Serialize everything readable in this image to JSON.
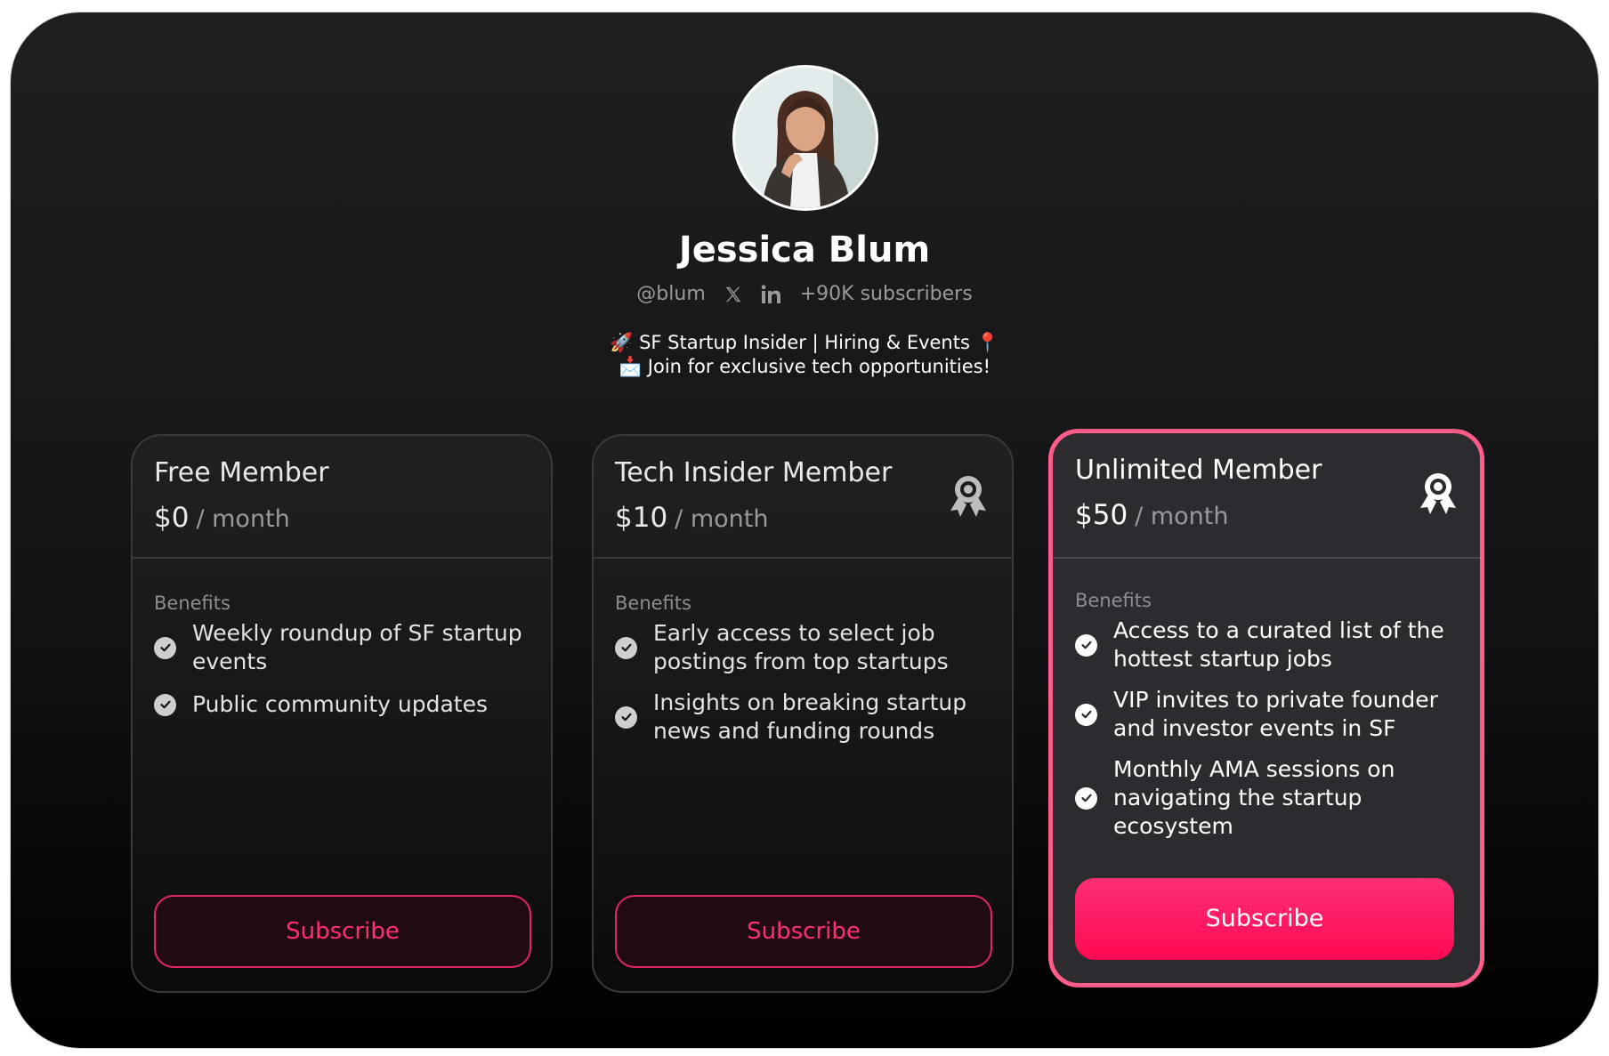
{
  "profile": {
    "name": "Jessica Blum",
    "handle": "@blum",
    "subscribers": "+90K subscribers",
    "bio_line1": "🚀 SF Startup Insider | Hiring & Events 📍",
    "bio_line2": "📩 Join for exclusive tech opportunities!",
    "social_icons": [
      "x-icon",
      "linkedin-icon"
    ]
  },
  "tiers": [
    {
      "title": "Free Member",
      "price": "$0",
      "period": "/ month",
      "benefits_label": "Benefits",
      "benefits": [
        "Weekly roundup of SF startup events",
        "Public community updates"
      ],
      "button": "Subscribe",
      "badge": false
    },
    {
      "title": "Tech Insider Member",
      "price": "$10",
      "period": "/ month",
      "benefits_label": "Benefits",
      "benefits": [
        "Early access to select job postings from top startups",
        "Insights on breaking startup news and funding rounds"
      ],
      "button": "Subscribe",
      "badge": true
    },
    {
      "title": "Unlimited Member",
      "price": "$50",
      "period": "/ month",
      "benefits_label": "Benefits",
      "benefits": [
        "Access to a curated list of the hottest startup jobs",
        "VIP invites to private founder and investor events in SF",
        "Monthly AMA sessions on navigating the startup ecosystem"
      ],
      "button": "Subscribe",
      "badge": true,
      "highlighted": true
    }
  ],
  "colors": {
    "accent": "#ff2e74",
    "highlight_border": "#ff5c8a",
    "background_top": "#1f1f21",
    "background_bottom": "#000000"
  }
}
